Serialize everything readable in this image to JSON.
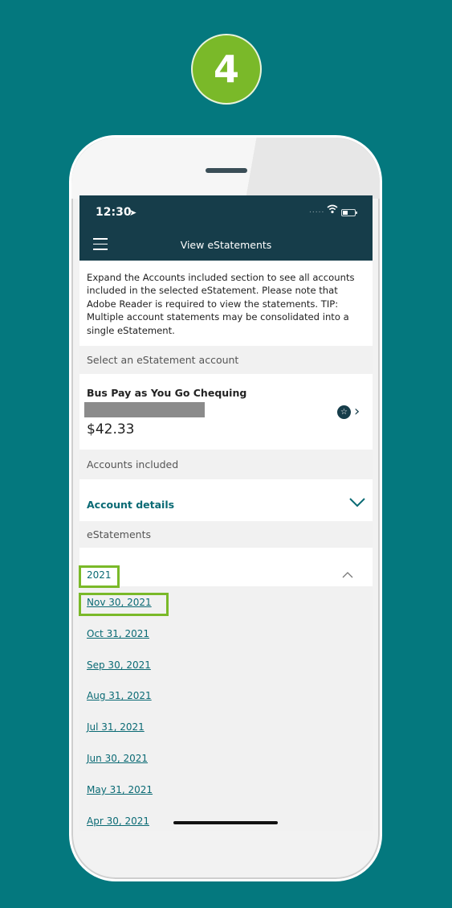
{
  "step_number": "4",
  "status_bar": {
    "time": "12:30",
    "signal": "....."
  },
  "navbar": {
    "title": "View eStatements"
  },
  "intro_text": "Expand the Accounts included section to see all accounts included in the selected eStatement. Please note that Adobe Reader is required to view the statements. TIP: Multiple account statements may be consolidated into a single eStatement.",
  "sections": {
    "select_account": "Select an eStatement account",
    "accounts_included": "Accounts included",
    "estatements": "eStatements"
  },
  "account": {
    "name": "Bus Pay as You Go Chequing",
    "balance": "$42.33"
  },
  "account_details_label": "Account details",
  "year": "2021",
  "statements": [
    "Nov 30, 2021",
    "Oct 31, 2021",
    "Sep 30, 2021",
    "Aug 31, 2021",
    "Jul 31, 2021",
    "Jun 30, 2021",
    "May 31, 2021",
    "Apr 30, 2021"
  ],
  "colors": {
    "background": "#04787e",
    "badge": "#7ab929",
    "header": "#163d4a",
    "link": "#0a6a74",
    "highlight": "#7ab929"
  },
  "icons": [
    "menu-icon",
    "location-arrow-icon",
    "wifi-icon",
    "battery-icon",
    "star-icon",
    "chevron-right-icon",
    "chevron-down-icon",
    "chevron-up-icon"
  ]
}
